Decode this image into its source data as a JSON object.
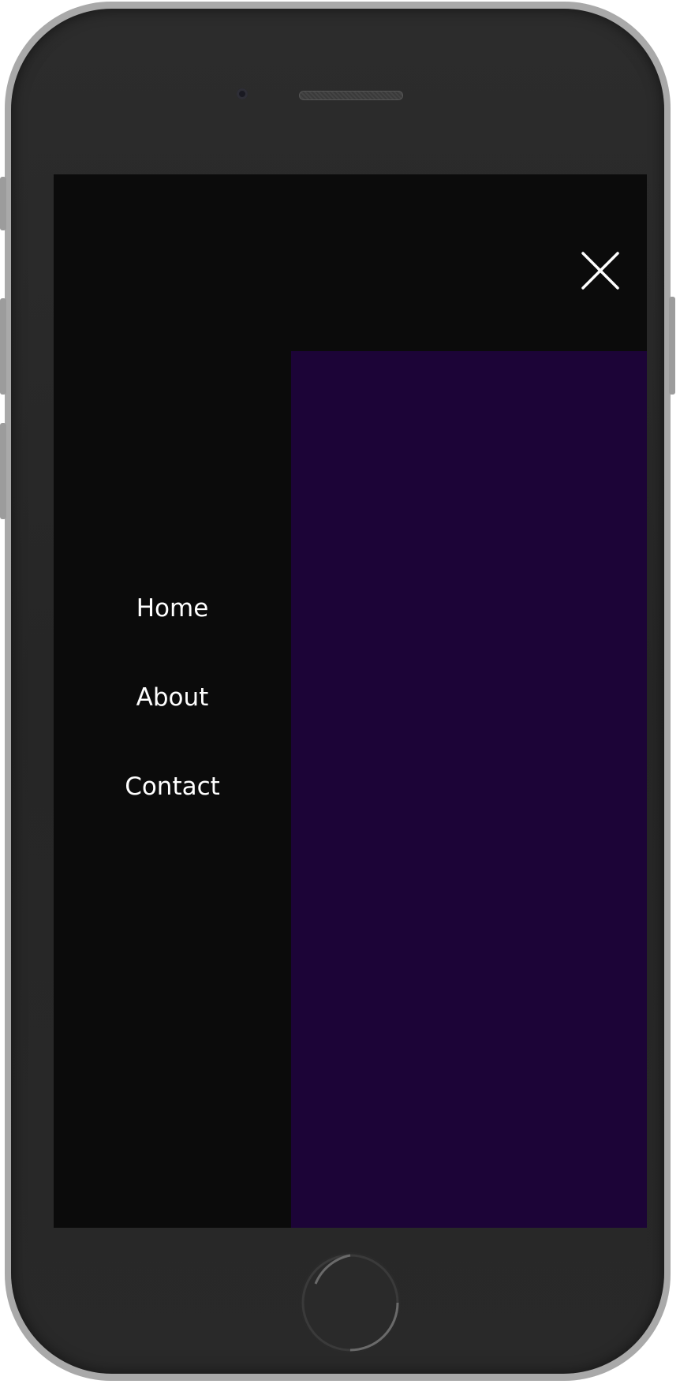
{
  "menu": {
    "items": [
      {
        "label": "Home"
      },
      {
        "label": "About"
      },
      {
        "label": "Contact"
      }
    ],
    "close_icon": "close-icon"
  },
  "colors": {
    "menu_background": "#0b0b0b",
    "content_background": "#1c0437",
    "menu_text": "#ffffff",
    "device_body": "#2a2a2a",
    "device_frame": "#a9a9a9"
  }
}
